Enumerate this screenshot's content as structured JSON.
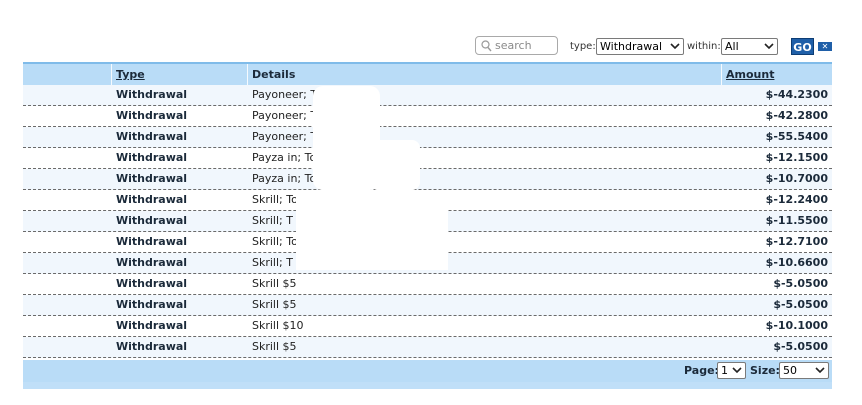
{
  "toolbar": {
    "search_placeholder": "search",
    "type_label": "type:",
    "type_value": "Withdrawal",
    "within_label": "within:",
    "within_value": "All",
    "go_label": "GO",
    "clear_label": "✕"
  },
  "table": {
    "columns": {
      "type": "Type",
      "details": "Details",
      "amount": "Amount"
    },
    "rows": [
      {
        "type": "Withdrawal",
        "details": "Payoneer; To:",
        "amount": "$-44.2300"
      },
      {
        "type": "Withdrawal",
        "details": "Payoneer; To:",
        "amount": "$-42.2800"
      },
      {
        "type": "Withdrawal",
        "details": "Payoneer; To:",
        "amount": "$-55.5400"
      },
      {
        "type": "Withdrawal",
        "details": "Payza in; To:                                    l.com",
        "amount": "$-12.1500"
      },
      {
        "type": "Withdrawal",
        "details": "Payza in; To:                                    om",
        "amount": "$-10.7000"
      },
      {
        "type": "Withdrawal",
        "details": "Skrill; To:                                      Fee: $0.12",
        "amount": "$-12.2400"
      },
      {
        "type": "Withdrawal",
        "details": "Skrill; T                                        Fee: $0.12",
        "amount": "$-11.5500"
      },
      {
        "type": "Withdrawal",
        "details": "Skrill; To                                       Fee: $0.13",
        "amount": "$-12.7100"
      },
      {
        "type": "Withdrawal",
        "details": "Skrill; T                                        Fee: $0.11",
        "amount": "$-10.6600"
      },
      {
        "type": "Withdrawal",
        "details": "Skrill $5",
        "amount": "$-5.0500"
      },
      {
        "type": "Withdrawal",
        "details": "Skrill $5",
        "amount": "$-5.0500"
      },
      {
        "type": "Withdrawal",
        "details": "Skrill $10",
        "amount": "$-10.1000"
      },
      {
        "type": "Withdrawal",
        "details": "Skrill $5",
        "amount": "$-5.0500"
      }
    ]
  },
  "pagination": {
    "page_label": "Page:",
    "page_value": "1",
    "size_label": "Size:",
    "size_value": "50"
  }
}
